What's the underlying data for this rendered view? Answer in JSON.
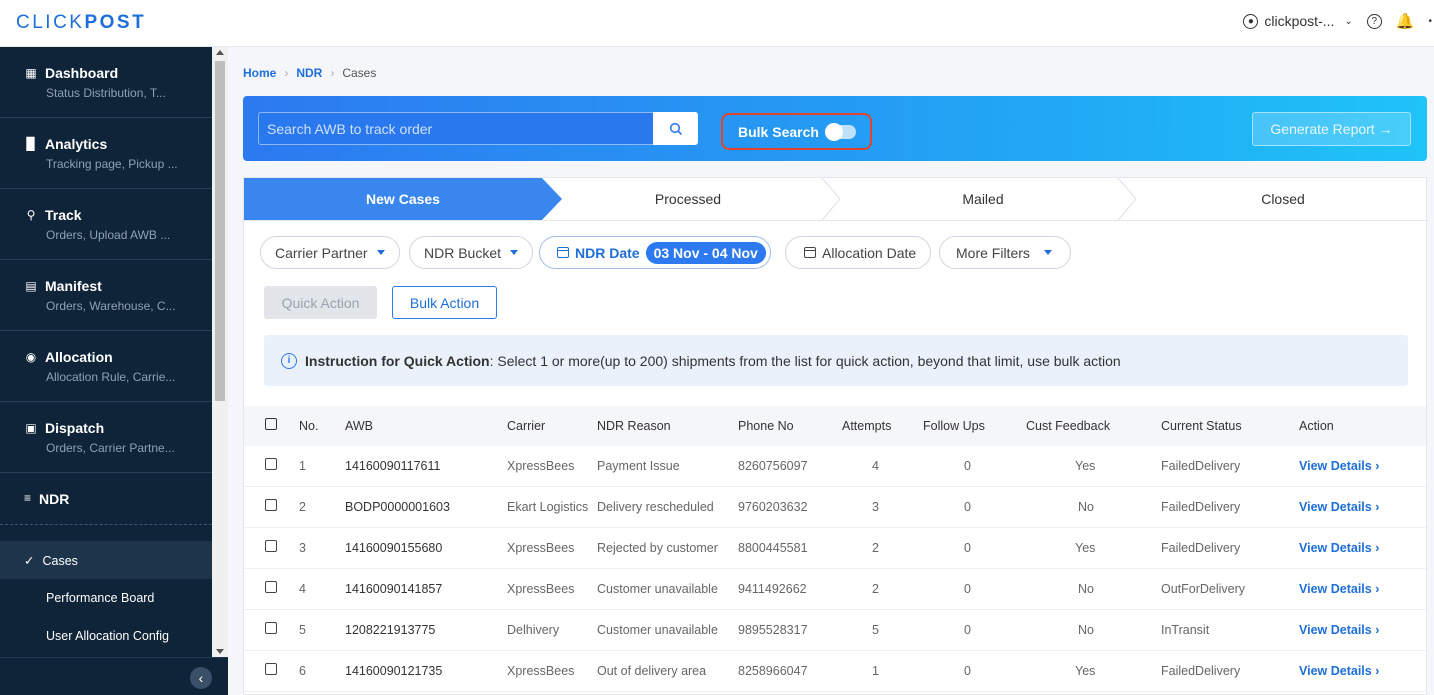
{
  "app": {
    "logo_light": "CLICK",
    "logo_bold": "POST",
    "account": "clickpost-..."
  },
  "sidebar": {
    "items": [
      {
        "title": "Dashboard",
        "sub": "Status Distribution, T...",
        "icon": "dashboard-icon"
      },
      {
        "title": "Analytics",
        "sub": "Tracking page, Pickup ...",
        "icon": "bar-chart-icon"
      },
      {
        "title": "Track",
        "sub": "Orders, Upload AWB ...",
        "icon": "location-pin-icon"
      },
      {
        "title": "Manifest",
        "sub": "Orders, Warehouse, C...",
        "icon": "list-icon"
      },
      {
        "title": "Allocation",
        "sub": "Allocation Rule, Carrie...",
        "icon": "target-icon"
      },
      {
        "title": "Dispatch",
        "sub": "Orders, Carrier Partne...",
        "icon": "bag-icon"
      }
    ],
    "ndr_title": "NDR",
    "sub_items": [
      "Cases",
      "Performance Board",
      "User Allocation Config"
    ]
  },
  "breadcrumb": [
    "Home",
    "NDR",
    "Cases"
  ],
  "hero": {
    "search_placeholder": "Search AWB to track order",
    "bulk_search": "Bulk Search",
    "generate_report": "Generate Report →"
  },
  "tabs": [
    "New Cases",
    "Processed",
    "Mailed",
    "Closed"
  ],
  "filters": {
    "carrier": "Carrier Partner",
    "bucket": "NDR Bucket",
    "ndr_date": "NDR Date",
    "ndr_date_range": "03 Nov - 04 Nov",
    "allocation_date": "Allocation Date",
    "more": "More Filters"
  },
  "actions": {
    "quick": "Quick Action",
    "bulk": "Bulk Action"
  },
  "instruction": {
    "bold": "Instruction for Quick Action",
    "text": ": Select 1 or more(up to 200) shipments from the list for quick action, beyond that limit, use bulk action"
  },
  "table": {
    "headers": [
      "No.",
      "AWB",
      "Carrier",
      "NDR Reason",
      "Phone No",
      "Attempts",
      "Follow Ups",
      "Cust Feedback",
      "Current Status",
      "Action"
    ],
    "rows": [
      {
        "no": "1",
        "awb": "14160090117611",
        "carrier": "XpressBees",
        "reason": "Payment Issue",
        "phone": "8260756097",
        "attempts": "4",
        "followups": "0",
        "feedback": "Yes",
        "status": "FailedDelivery",
        "action": "View Details"
      },
      {
        "no": "2",
        "awb": "BODP0000001603",
        "carrier": "Ekart Logistics",
        "reason": "Delivery rescheduled",
        "phone": "9760203632",
        "attempts": "3",
        "followups": "0",
        "feedback": "No",
        "status": "FailedDelivery",
        "action": "View Details"
      },
      {
        "no": "3",
        "awb": "14160090155680",
        "carrier": "XpressBees",
        "reason": "Rejected by customer",
        "phone": "8800445581",
        "attempts": "2",
        "followups": "0",
        "feedback": "Yes",
        "status": "FailedDelivery",
        "action": "View Details"
      },
      {
        "no": "4",
        "awb": "14160090141857",
        "carrier": "XpressBees",
        "reason": "Customer unavailable",
        "phone": "9411492662",
        "attempts": "2",
        "followups": "0",
        "feedback": "No",
        "status": "OutForDelivery",
        "action": "View Details"
      },
      {
        "no": "5",
        "awb": "1208221913775",
        "carrier": "Delhivery",
        "reason": "Customer unavailable",
        "phone": "9895528317",
        "attempts": "5",
        "followups": "0",
        "feedback": "No",
        "status": "InTransit",
        "action": "View Details"
      },
      {
        "no": "6",
        "awb": "14160090121735",
        "carrier": "XpressBees",
        "reason": "Out of delivery area",
        "phone": "8258966047",
        "attempts": "1",
        "followups": "0",
        "feedback": "Yes",
        "status": "FailedDelivery",
        "action": "View Details"
      }
    ]
  },
  "colors": {
    "brand": "#1e6fd9",
    "sidebar_bg": "#0f2438",
    "highlight_border": "#e0442f"
  }
}
